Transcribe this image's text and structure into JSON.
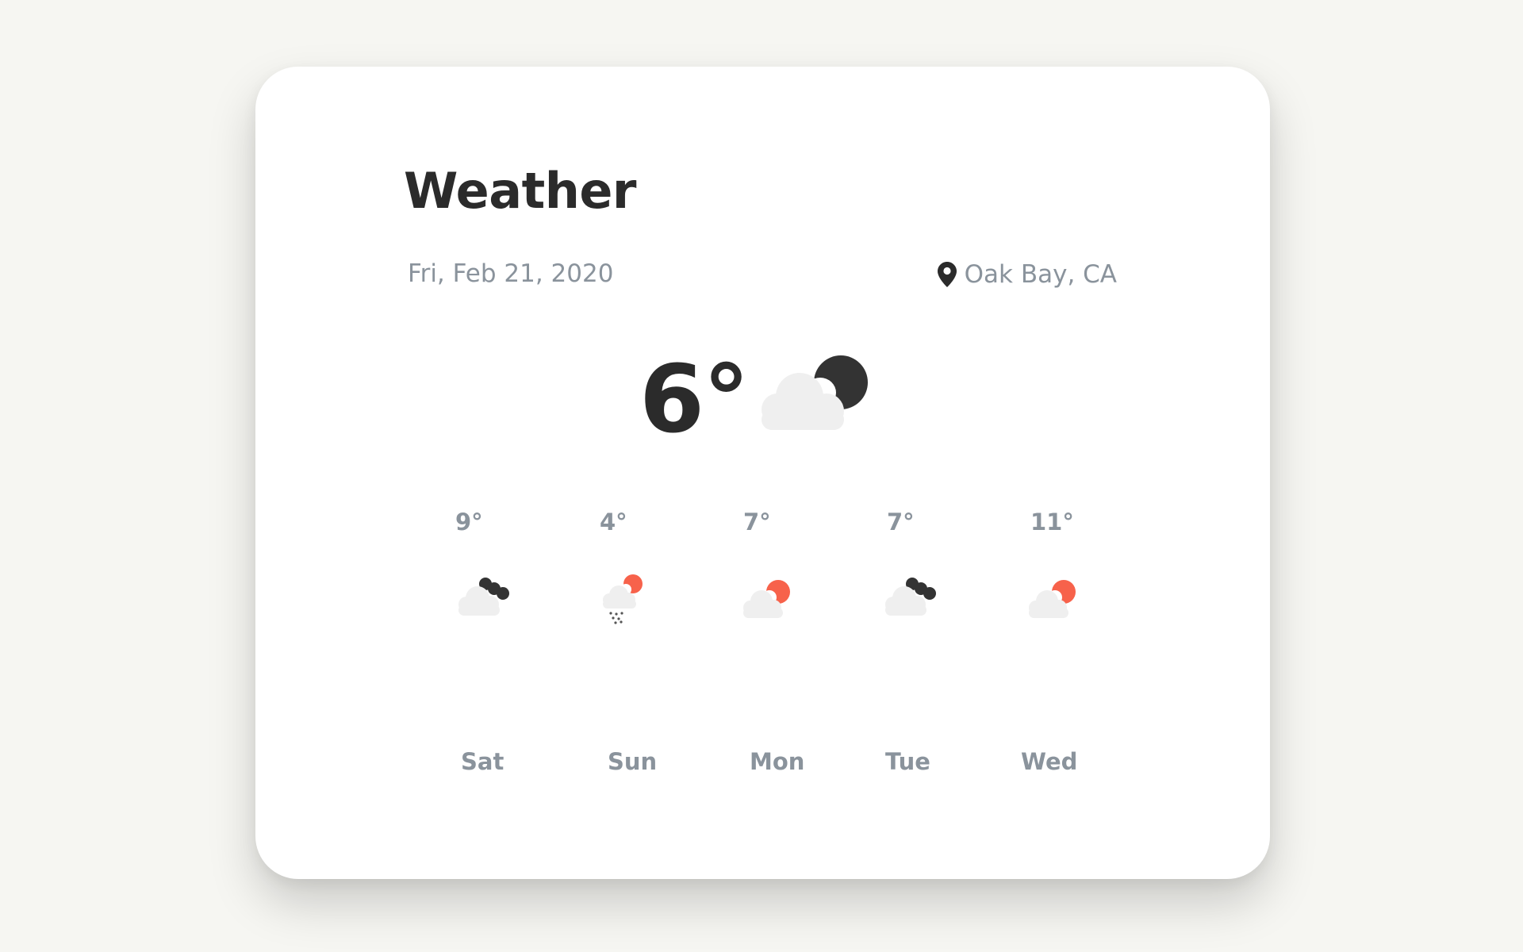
{
  "weather": {
    "title": "Weather",
    "date": "Fri, Feb 21, 2020",
    "location": "Oak Bay, CA",
    "current": {
      "temp": "6°",
      "icon": "cloud-moon-icon"
    },
    "forecast": [
      {
        "day": "Sat",
        "temp": "9°",
        "icon": "cloud-dark-moon-icon"
      },
      {
        "day": "Sun",
        "temp": "4°",
        "icon": "cloud-sun-snow-icon"
      },
      {
        "day": "Mon",
        "temp": "7°",
        "icon": "cloud-sun-icon"
      },
      {
        "day": "Tue",
        "temp": "7°",
        "icon": "cloud-dark-moon-icon"
      },
      {
        "day": "Wed",
        "temp": "11°",
        "icon": "cloud-sun-icon"
      }
    ]
  },
  "colors": {
    "background": "#f6f6f2",
    "card": "#ffffff",
    "text_dark": "#2b2b2b",
    "text_muted": "#8a939c",
    "cloud": "#eeeeee",
    "moon": "#333333",
    "sun": "#f7624b"
  }
}
